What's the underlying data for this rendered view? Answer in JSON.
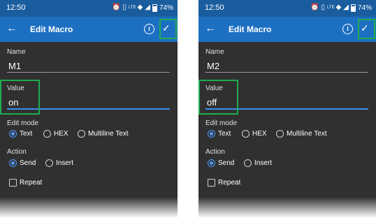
{
  "status": {
    "time": "12:50",
    "battery": "74%",
    "network": "LTE",
    "icons": [
      "alarm-icon",
      "vibrate-icon",
      "wifi-icon",
      "signal-icon",
      "battery-icon"
    ]
  },
  "colors": {
    "statusbar": "#1a5d9e",
    "appbar": "#1d6fc2",
    "background": "#303030",
    "accent": "#4f9bff",
    "highlight": "#1fad4f"
  },
  "screens": [
    {
      "title": "Edit Macro",
      "name_label": "Name",
      "name_value": "M1",
      "value_label": "Value",
      "value_value": "on",
      "edit_mode_label": "Edit mode",
      "edit_modes": [
        "Text",
        "HEX",
        "Multiline Text"
      ],
      "edit_mode_selected": "Text",
      "action_label": "Action",
      "actions": [
        "Send",
        "Insert"
      ],
      "action_selected": "Send",
      "repeat_label": "Repeat",
      "repeat_checked": false
    },
    {
      "title": "Edit Macro",
      "name_label": "Name",
      "name_value": "M2",
      "value_label": "Value",
      "value_value": "off",
      "edit_mode_label": "Edit mode",
      "edit_modes": [
        "Text",
        "HEX",
        "Multiline Text"
      ],
      "edit_mode_selected": "Text",
      "action_label": "Action",
      "actions": [
        "Send",
        "Insert"
      ],
      "action_selected": "Send",
      "repeat_label": "Repeat",
      "repeat_checked": false
    }
  ]
}
